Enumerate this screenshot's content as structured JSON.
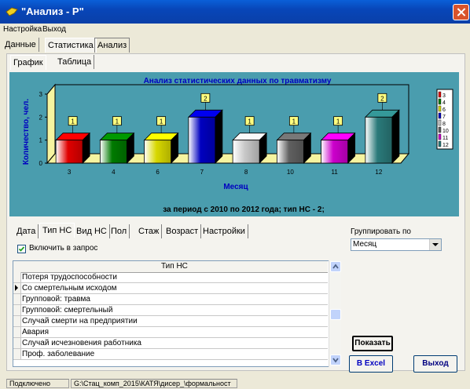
{
  "window": {
    "title": "\"Анализ - Р\""
  },
  "menu": {
    "items": [
      "Настройка",
      "Выход"
    ]
  },
  "main_tabs": [
    "Данные",
    "Статистика",
    "Анализ"
  ],
  "sub_tabs": [
    "График",
    "Таблица"
  ],
  "filter_tabs": [
    "Дата",
    "Тип НС",
    "Вид НС",
    "Пол",
    "Стаж",
    "Возраст",
    "Настройки"
  ],
  "include_checkbox": {
    "label": "Включить в запрос",
    "checked": true
  },
  "grid": {
    "header": "Тип НС",
    "rows": [
      "Потеря трудоспособности",
      "Со смертельным исходом",
      "Групповой: травма",
      "Групповой: смертельный",
      "Случай смерти на предприятии",
      "Авария",
      "Случай исчезновения работника",
      "Проф. заболевание"
    ],
    "selected_row": 1
  },
  "group_by": {
    "label": "Группировать по",
    "value": "Месяц"
  },
  "buttons": {
    "show": "Показать",
    "excel": "В Excel",
    "exit": "Выход"
  },
  "status": {
    "state": "Подключено",
    "path": "G:\\Стац_комп_2015\\КАТЯ\\дисер_\\формальност"
  },
  "colors": {
    "titlebar": "#0A5FD8",
    "chart_bg": "#4A9DAE",
    "chart_title": "#0000C0"
  },
  "chart_data": {
    "type": "bar",
    "title": "Анализ статистических данных по травматизму",
    "subtitle": "за период с 2010 по 2012 года;  тип НС - 2;",
    "xlabel": "Месяц",
    "ylabel": "Количество, чел.",
    "ylim": [
      0,
      3
    ],
    "yticks": [
      "0",
      "1",
      "2",
      "3"
    ],
    "categories": [
      "3",
      "4",
      "6",
      "7",
      "8",
      "10",
      "11",
      "12"
    ],
    "values": [
      1,
      1,
      1,
      2,
      1,
      1,
      1,
      2
    ],
    "bar_colors": [
      "#E00000",
      "#007A00",
      "#D8D800",
      "#0000C0",
      "#C8C8C8",
      "#606060",
      "#CC00CC",
      "#2A7A7A"
    ],
    "legend": [
      "3",
      "4",
      "6",
      "7",
      "8",
      "10",
      "11",
      "12"
    ],
    "legend_position": "right",
    "grid": false
  }
}
